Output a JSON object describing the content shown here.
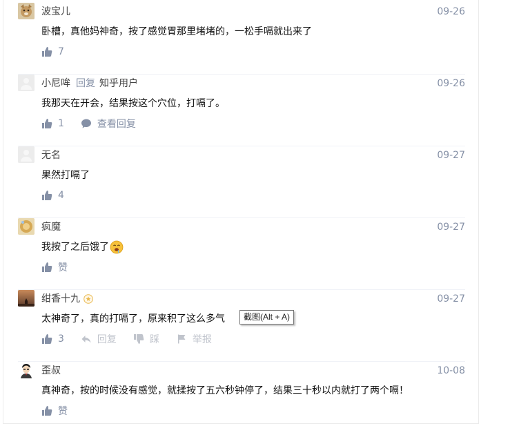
{
  "comments": [
    {
      "author": "波宝儿",
      "date": "09-26",
      "content": "卧槽，真他妈神奇，按了感觉胃那里堵堵的，一松手嗝就出来了",
      "likes": "7"
    },
    {
      "author": "小尼哞",
      "reply_word": "回复",
      "reply_to": "知乎用户",
      "date": "09-26",
      "content": "我那天在开会，结果按这个穴位，打嗝了。",
      "likes": "1",
      "view_replies": "查看回复"
    },
    {
      "author": "无名",
      "date": "09-27",
      "content": "果然打嗝了",
      "likes": "4"
    },
    {
      "author": "疯魔",
      "date": "09-27",
      "content": "我按了之后饿了",
      "likes": "赞"
    },
    {
      "author": "绀香十九",
      "date": "09-27",
      "content": "太神奇了，真的打嗝了，原来积了这么多气",
      "likes": "3",
      "reply": "回复",
      "dislike": "踩",
      "report": "举报"
    },
    {
      "author": "歪叔",
      "date": "10-08",
      "content": "真神奇，按的时候没有感觉，就揉按了五六秒钟停了，结果三十秒以内就打了两个嗝！",
      "likes": "赞"
    }
  ],
  "tooltip": "截图(Alt + A)",
  "colors": {
    "meta": "#8590a6",
    "text": "#121212",
    "divider": "#f0f2f7"
  }
}
